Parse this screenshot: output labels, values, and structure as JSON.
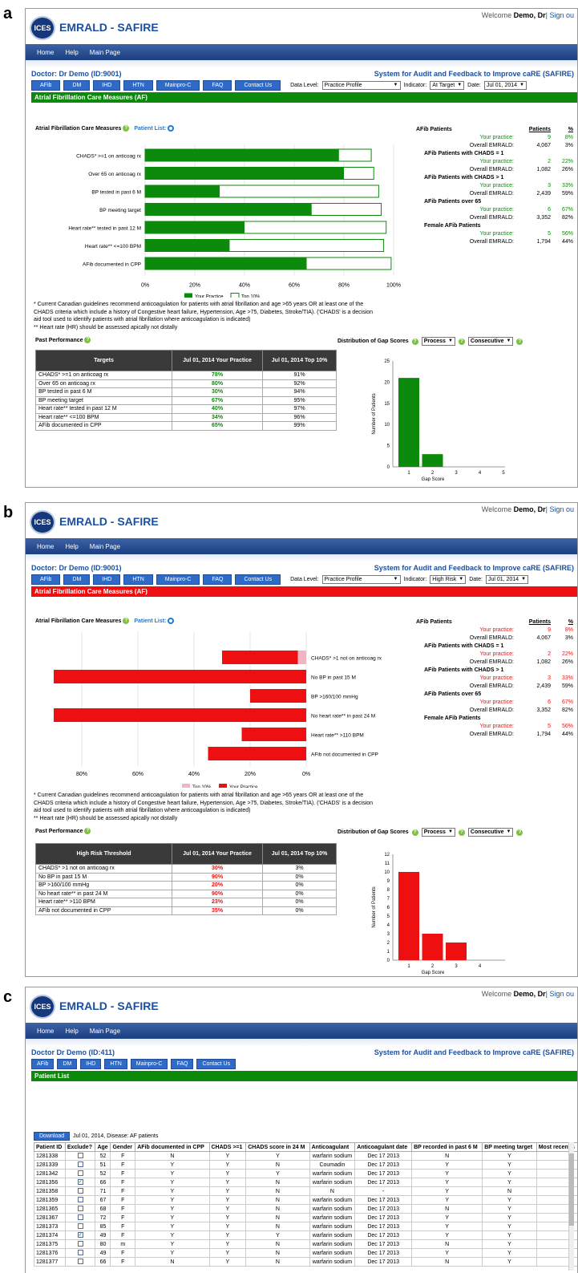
{
  "panel_labels": [
    "a",
    "b",
    "c"
  ],
  "app": {
    "logo": "ICES",
    "title": "EMRALD - SAFIRE",
    "welcome_prefix": "Welcome ",
    "welcome_user": "Demo, Dr",
    "sign_out": "| Sign ou",
    "system_title": "System for Audit and Feedback to Improve caRE (SAFIRE)"
  },
  "nav": [
    "Home",
    "Help",
    "Main Page"
  ],
  "tabs": [
    "AFib",
    "DM",
    "IHD",
    "HTN",
    "Mainpro-C",
    "FAQ",
    "Contact Us"
  ],
  "controls": {
    "data_level_label": "Data Level:",
    "data_level": "Practice Profile",
    "indicator_label": "Indicator:",
    "date_label": "Date:",
    "date": "Jul 01, 2014"
  },
  "afib_stats": {
    "header": "AFib Patients",
    "col_patients": "Patients",
    "col_pct": "%",
    "your": "Your practice:",
    "overall": "Overall EMRALD:",
    "groups": [
      {
        "title": "AFib Patients",
        "your_n": "9",
        "your_p": "8%",
        "all_n": "4,067",
        "all_p": "3%"
      },
      {
        "title": "AFib Patients with CHADS = 1",
        "your_n": "2",
        "your_p": "22%",
        "all_n": "1,082",
        "all_p": "26%"
      },
      {
        "title": "AFib Patients with CHADS > 1",
        "your_n": "3",
        "your_p": "33%",
        "all_n": "2,439",
        "all_p": "59%"
      },
      {
        "title": "AFib Patients over 65",
        "your_n": "6",
        "your_p": "67%",
        "all_n": "3,352",
        "all_p": "82%"
      },
      {
        "title": "Female AFib Patients",
        "your_n": "5",
        "your_p": "56%",
        "all_n": "1,794",
        "all_p": "44%"
      }
    ]
  },
  "notes": {
    "line1": "* Current Canadian guidelines recommend anticoagulation for patients with atrial fibrillation and age >65 years OR at least one of the",
    "line2": "CHADS criteria which include a history of Congestive heart failure, Hypertension, Age >75, Diabetes, Stroke/TIA). ('CHADS' is a decision",
    "line3": "aid tool used to identify patients with atrial fibrillation where anticoagulation is indicated)",
    "line4": "** Heart rate (HR) should be assessed apically not distally"
  },
  "past_performance": "Past Performance",
  "gap_label": "Distribution of Gap Scores",
  "gap_sel1": "Process",
  "gap_sel2": "Consecutive",
  "panel_a": {
    "doctor": "Doctor: Dr Demo (ID:9001)",
    "indicator": "At Target",
    "section_bar": "Atrial Fibrillation Care Measures (AF)",
    "measures_title": "Atrial Fibrillation Care Measures",
    "patient_list": "Patient List:",
    "table_header": [
      "Targets",
      "Jul 01, 2014 Your Practice",
      "Jul 01, 2014 Top 10%"
    ],
    "table_rows": [
      [
        "CHADS* >=1 on anticoag rx",
        "78%",
        "91%"
      ],
      [
        "Over 65 on anticoag rx",
        "80%",
        "92%"
      ],
      [
        "BP tested in past 6 M",
        "30%",
        "94%"
      ],
      [
        "BP meeting target",
        "67%",
        "95%"
      ],
      [
        "Heart rate** tested in past 12 M",
        "40%",
        "97%"
      ],
      [
        "Heart rate** <=100 BPM",
        "34%",
        "96%"
      ],
      [
        "AFib documented in CPP",
        "65%",
        "99%"
      ]
    ]
  },
  "panel_b": {
    "doctor": "Doctor: Dr Demo (ID:9001)",
    "indicator": "High Risk",
    "section_bar": "Atrial Fibrillation Care Measures (AF)",
    "measures_title": "Atrial Fibrillation Care Measures",
    "patient_list": "Patient List:",
    "table_header": [
      "High Risk Threshold",
      "Jul 01, 2014 Your Practice",
      "Jul 01, 2014 Top 10%"
    ],
    "table_rows": [
      [
        "CHADS* >1 not on anticoag rx",
        "30%",
        "3%"
      ],
      [
        "No BP in past 15 M",
        "90%",
        "0%"
      ],
      [
        "BP >160/100 mmHg",
        "20%",
        "0%"
      ],
      [
        "No heart rate** in past 24 M",
        "90%",
        "0%"
      ],
      [
        "Heart rate** >110 BPM",
        "23%",
        "0%"
      ],
      [
        "AFib not documented in CPP",
        "35%",
        "0%"
      ]
    ]
  },
  "panel_c": {
    "doctor": "Doctor Dr Demo (ID:411)",
    "section_bar": "Patient List",
    "download": "Download",
    "download_info": "Jul 01, 2014, Disease: AF patients",
    "columns": [
      "Patient ID",
      "Exclude?",
      "Age",
      "Gender",
      "AFib documented in CPP",
      "CHADS >=1",
      "CHADS score in 24 M",
      "Anticoagulant",
      "Anticoagulant date",
      "BP recorded in past 6 M",
      "BP meeting target",
      "Most recent s"
    ],
    "rows": [
      [
        "1281338",
        false,
        "52",
        "F",
        "N",
        "Y",
        "Y",
        "warfarin sodium",
        "Dec 17 2013",
        "N",
        "Y"
      ],
      [
        "1281339",
        false,
        "51",
        "F",
        "Y",
        "Y",
        "N",
        "Coumadin",
        "Dec 17 2013",
        "Y",
        "Y"
      ],
      [
        "1281342",
        false,
        "52",
        "F",
        "Y",
        "Y",
        "Y",
        "warfarin sodium",
        "Dec 17 2013",
        "Y",
        "Y"
      ],
      [
        "1281356",
        true,
        "66",
        "F",
        "Y",
        "Y",
        "N",
        "warfarin sodium",
        "Dec 17 2013",
        "Y",
        "Y"
      ],
      [
        "1281358",
        false,
        "71",
        "F",
        "Y",
        "Y",
        "N",
        "N",
        "-",
        "Y",
        "N"
      ],
      [
        "1281359",
        false,
        "67",
        "F",
        "Y",
        "Y",
        "N",
        "warfarin sodium",
        "Dec 17 2013",
        "Y",
        "Y"
      ],
      [
        "1281365",
        false,
        "68",
        "F",
        "Y",
        "Y",
        "N",
        "warfarin sodium",
        "Dec 17 2013",
        "N",
        "Y"
      ],
      [
        "1281367",
        false,
        "72",
        "F",
        "Y",
        "Y",
        "N",
        "warfarin sodium",
        "Dec 17 2013",
        "Y",
        "Y"
      ],
      [
        "1281373",
        false,
        "85",
        "F",
        "Y",
        "Y",
        "N",
        "warfarin sodium",
        "Dec 17 2013",
        "Y",
        "Y"
      ],
      [
        "1281374",
        true,
        "49",
        "F",
        "Y",
        "Y",
        "Y",
        "warfarin sodium",
        "Dec 17 2013",
        "Y",
        "Y"
      ],
      [
        "1281375",
        false,
        "80",
        "m",
        "Y",
        "Y",
        "N",
        "warfarin sodium",
        "Dec 17 2013",
        "N",
        "Y"
      ],
      [
        "1281376",
        false,
        "49",
        "F",
        "Y",
        "Y",
        "N",
        "warfarin sodium",
        "Dec 17 2013",
        "Y",
        "Y"
      ],
      [
        "1281377",
        false,
        "66",
        "F",
        "N",
        "Y",
        "N",
        "warfarin sodium",
        "Dec 17 2013",
        "N",
        "Y"
      ]
    ]
  },
  "chart_data": [
    {
      "type": "bar",
      "orientation": "horizontal",
      "categories": [
        "CHADS* >=1 on anticoag rx",
        "Over 65 on anticoag rx",
        "BP tested in past 6 M",
        "BP meeting target",
        "Heart rate** tested in past 12 M",
        "Heart rate** <=100 BPM",
        "AFib documented in CPP"
      ],
      "series": [
        {
          "name": "Your Practice",
          "values": [
            78,
            80,
            30,
            67,
            40,
            34,
            65
          ],
          "color": "#0b8a0b"
        },
        {
          "name": "Top 10%",
          "values": [
            91,
            92,
            94,
            95,
            97,
            96,
            99
          ],
          "color": "#ffffff"
        }
      ],
      "xticks": [
        "0%",
        "20%",
        "40%",
        "60%",
        "80%",
        "100%"
      ],
      "xlim": [
        0,
        100
      ]
    },
    {
      "type": "bar",
      "orientation": "horizontal-reversed",
      "categories": [
        "CHADS* >1 not on anticoag rx",
        "No BP in past 15 M",
        "BP >160/100 mmHg",
        "No heart rate** in past 24 M",
        "Heart rate** >110 BPM",
        "AFib not documented in CPP"
      ],
      "series": [
        {
          "name": "Top 10%",
          "values": [
            3,
            0,
            0,
            0,
            0,
            0
          ],
          "color": "#f4b3c2"
        },
        {
          "name": "Your Practice",
          "values": [
            30,
            90,
            20,
            90,
            23,
            35
          ],
          "color": "#ee1010"
        }
      ],
      "xticks": [
        "80%",
        "60%",
        "40%",
        "20%",
        "0%"
      ],
      "xlim": [
        0,
        90
      ]
    },
    {
      "type": "bar",
      "categories": [
        "1",
        "2",
        "3",
        "4",
        "5"
      ],
      "values": [
        21,
        3,
        0,
        0,
        0
      ],
      "color": "#0b8a0b",
      "xlabel": "Gap Score",
      "ylabel": "Number of Patients",
      "yticks": [
        "0",
        "5",
        "10",
        "15",
        "20",
        "25"
      ],
      "ylim": [
        0,
        25
      ]
    },
    {
      "type": "bar",
      "categories": [
        "1",
        "2",
        "3",
        "4"
      ],
      "values": [
        10,
        3,
        2,
        0
      ],
      "color": "#ee1010",
      "xlabel": "Gap Score",
      "ylabel": "Number of Patients",
      "yticks": [
        "0",
        "1",
        "2",
        "3",
        "4",
        "5",
        "6",
        "7",
        "8",
        "9",
        "10",
        "11",
        "12"
      ],
      "ylim": [
        0,
        12
      ]
    }
  ]
}
